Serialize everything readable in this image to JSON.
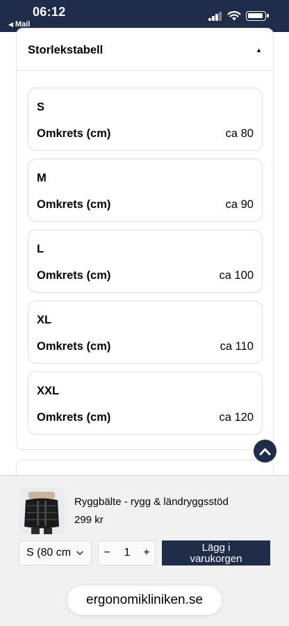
{
  "status_bar": {
    "time": "06:12",
    "back_label": "Mail"
  },
  "size_table": {
    "title": "Storlekstabell",
    "rows": [
      {
        "size": "S",
        "label": "Omkrets (cm)",
        "value": "ca 80"
      },
      {
        "size": "M",
        "label": "Omkrets (cm)",
        "value": "ca 90"
      },
      {
        "size": "L",
        "label": "Omkrets (cm)",
        "value": "ca 100"
      },
      {
        "size": "XL",
        "label": "Omkrets (cm)",
        "value": "ca 110"
      },
      {
        "size": "XXL",
        "label": "Omkrets (cm)",
        "value": "ca 120"
      }
    ]
  },
  "product": {
    "name": "Ryggbälte - rygg & ländryggsstöd",
    "price": "299 kr",
    "variant": "S (80 cm",
    "quantity": "1",
    "minus": "−",
    "plus": "+",
    "add_to_cart": "Lägg i varukorgen"
  },
  "browser": {
    "url": "ergonomikliniken.se"
  },
  "colors": {
    "navy": "#1f2d4a",
    "border": "#dcdcdc"
  }
}
